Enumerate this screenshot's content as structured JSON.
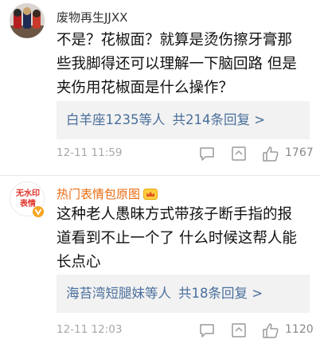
{
  "comments": [
    {
      "username": "废物再生JJXX",
      "lines": [
        "不是？花椒面？就算是烫伤擦牙膏那",
        "些我脚得还可以理解一下脑回路 但是",
        "夹伤用花椒面是什么操作？"
      ],
      "replies_by": "白羊座1235等人",
      "replies_count": "共214条回复 >",
      "timestamp": "12-11 11:59",
      "likes": "1767"
    },
    {
      "username": "热门表情包原图",
      "avatar_text_top": "无水印",
      "avatar_text_bottom": "表情",
      "lines": [
        "这种老人愚昧方式带孩子断手指的报",
        "道看到不止一个了 什么时候这帮人能",
        "长点心"
      ],
      "replies_by": "海苔湾短腿妹等人",
      "replies_count": "共18条回复 >",
      "timestamp": "12-11 12:03",
      "likes": "1120"
    }
  ],
  "icons": [
    "comment-icon",
    "share-icon",
    "thumbs-up-icon",
    "crown-badge-icon",
    "verified-badge-icon"
  ],
  "colors": {
    "username_vip": "#e86b10",
    "reply_link": "#4a6f9c",
    "meta_gray": "#a8a8a8"
  }
}
